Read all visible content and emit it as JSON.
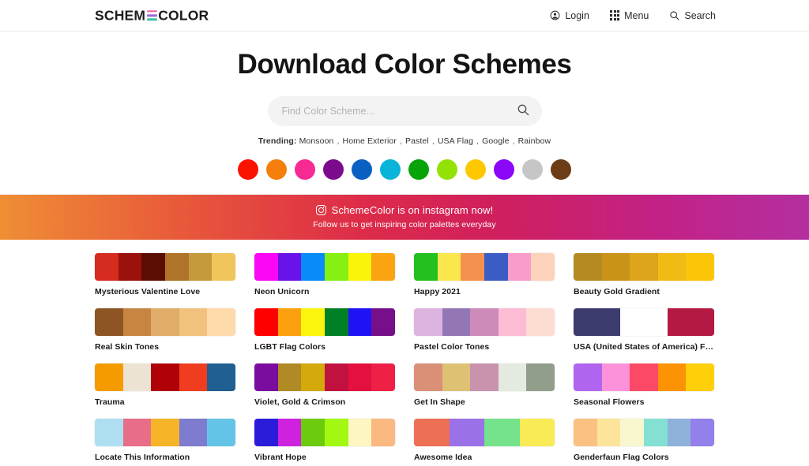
{
  "header": {
    "logo": {
      "text_before": "SCHEM",
      "text_after": "COLOR",
      "bar_colors": [
        "#ef5fa7",
        "#9b6ae0",
        "#3fc1a6"
      ]
    },
    "nav": [
      {
        "label": "Login",
        "icon": "user-circle-icon"
      },
      {
        "label": "Menu",
        "icon": "grid-menu-icon"
      },
      {
        "label": "Search",
        "icon": "search-icon"
      }
    ]
  },
  "hero": {
    "title": "Download Color Schemes",
    "search": {
      "placeholder": "Find Color Scheme...",
      "value": "",
      "button_icon": "search-icon"
    },
    "trending": {
      "label": "Trending:",
      "items": [
        "Monsoon",
        "Home Exterior",
        "Pastel",
        "USA Flag",
        "Google",
        "Rainbow"
      ]
    },
    "color_dots": [
      {
        "name": "red",
        "hex": "#FA1300"
      },
      {
        "name": "orange",
        "hex": "#F57F0C"
      },
      {
        "name": "pink",
        "hex": "#F72A93"
      },
      {
        "name": "purple",
        "hex": "#7B0B8C"
      },
      {
        "name": "blue",
        "hex": "#0A60C2"
      },
      {
        "name": "cyan",
        "hex": "#09B4D8"
      },
      {
        "name": "green",
        "hex": "#07A309"
      },
      {
        "name": "lime",
        "hex": "#92E305"
      },
      {
        "name": "yellow",
        "hex": "#FEC800"
      },
      {
        "name": "violet",
        "hex": "#8C06F8"
      },
      {
        "name": "gray",
        "hex": "#C6C6C6"
      },
      {
        "name": "brown",
        "hex": "#6B3C16"
      }
    ]
  },
  "instagram_banner": {
    "icon": "instagram-icon",
    "headline": "SchemeColor is on instagram now!",
    "subtext": "Follow us to get inspiring color palettes everyday",
    "gradient_from": "#EF8E35",
    "gradient_to": "#B42FA0"
  },
  "palettes": [
    {
      "name": "Mysterious Valentine Love",
      "colors": [
        "#D62B1F",
        "#9A120B",
        "#5B0D04",
        "#AF7429",
        "#C49A3D",
        "#F0C65C"
      ]
    },
    {
      "name": "Neon Unicorn",
      "colors": [
        "#FC07F5",
        "#6A13E8",
        "#0A8BFA",
        "#85F012",
        "#FAF40B",
        "#FAA411"
      ]
    },
    {
      "name": "Happy 2021",
      "colors": [
        "#24BF21",
        "#FAE74E",
        "#F5914E",
        "#3B5CC4",
        "#F79CCB",
        "#FBD2BA"
      ]
    },
    {
      "name": "Beauty Gold Gradient",
      "colors": [
        "#B68A22",
        "#C99317",
        "#DCA51A",
        "#F0BB14",
        "#FCC608"
      ]
    },
    {
      "name": "Real Skin Tones",
      "colors": [
        "#8D5524",
        "#C68642",
        "#E0AC69",
        "#F1C27D",
        "#FFDBAC"
      ]
    },
    {
      "name": "LGBT Flag Colors",
      "colors": [
        "#FE0000",
        "#FDA00E",
        "#FBF50E",
        "#008026",
        "#1E12F7",
        "#770F89"
      ]
    },
    {
      "name": "Pastel Color Tones",
      "colors": [
        "#DDB3E0",
        "#9377B5",
        "#CD8BBB",
        "#FCBCD4",
        "#FDDCD2"
      ]
    },
    {
      "name": "USA (United States of America) Flag ...",
      "colors": [
        "#3C3B6E",
        "#FFFFFF",
        "#B31942"
      ]
    },
    {
      "name": "Trauma",
      "colors": [
        "#F59B00",
        "#EDE3D4",
        "#B00008",
        "#F03D20",
        "#1F5F92"
      ]
    },
    {
      "name": "Violet, Gold & Crimson",
      "colors": [
        "#7B0D9E",
        "#B08A24",
        "#D4A90B",
        "#C1123F",
        "#E4103F",
        "#EE2046"
      ]
    },
    {
      "name": "Get In Shape",
      "colors": [
        "#DA9076",
        "#DEC274",
        "#C993AD",
        "#E5EAE1",
        "#919E8B"
      ]
    },
    {
      "name": "Seasonal Flowers",
      "colors": [
        "#B065F0",
        "#FC92DA",
        "#FC4966",
        "#FB9305",
        "#FFCF09"
      ]
    },
    {
      "name": "Locate This Information",
      "colors": [
        "#AEDFF0",
        "#E86D88",
        "#F6B429",
        "#7D7CCE",
        "#64C4E8"
      ]
    },
    {
      "name": "Vibrant Hope",
      "colors": [
        "#2B1CD9",
        "#CE22DE",
        "#6DCB0D",
        "#A3F811",
        "#FDF6C0",
        "#FBB880"
      ]
    },
    {
      "name": "Awesome Idea",
      "colors": [
        "#ED7055",
        "#9B71E8",
        "#74E38B",
        "#F9EB56"
      ]
    },
    {
      "name": "Genderfaun Flag Colors",
      "colors": [
        "#FBC182",
        "#FCE59A",
        "#F9F7D0",
        "#83E0D3",
        "#8FB2DB",
        "#9380EA"
      ]
    }
  ]
}
